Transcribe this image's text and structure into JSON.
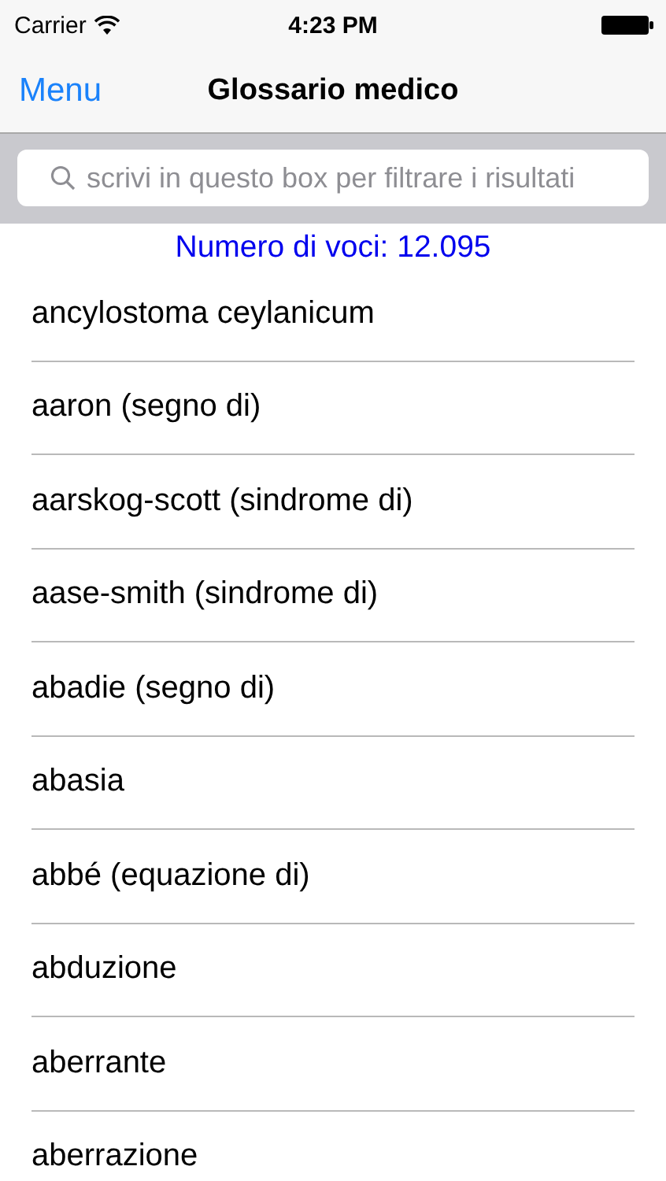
{
  "status_bar": {
    "carrier": "Carrier",
    "time": "4:23 PM"
  },
  "nav_bar": {
    "left_button": "Menu",
    "title": "Glossario medico"
  },
  "search": {
    "placeholder": "scrivi in questo box per filtrare i risultati"
  },
  "count": "Numero di voci: 12.095",
  "items": [
    "ancylostoma ceylanicum",
    "aaron (segno di)",
    "aarskog-scott (sindrome di)",
    "aase-smith (sindrome di)",
    "abadie (segno di)",
    "abasia",
    "abbé (equazione di)",
    "abduzione",
    "aberrante",
    "aberrazione"
  ]
}
